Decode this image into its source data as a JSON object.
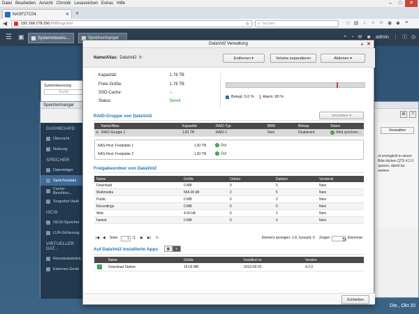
{
  "browser": {
    "menu": [
      "Datei",
      "Bearbeiten",
      "Ansicht",
      "Chronik",
      "Lesezeichen",
      "Extras",
      "Hilfe"
    ],
    "tab_title": "NASF27C04",
    "url_host": "192.168.178.150",
    "url_path": ":8080/cgi-bin/",
    "search_placeholder": "Suchen"
  },
  "qts": {
    "tabs": [
      "Systemsteueru...",
      "Speichermanger"
    ],
    "user": "admin",
    "taskbar_time": "Die., Okt 20"
  },
  "sysctl_popup": {
    "title": "Systemsteuerung",
    "search": "Suche"
  },
  "storage_manager": {
    "title": "Speichermanger",
    "sections": [
      {
        "title": "DASHBOARD",
        "items": [
          "Übersicht",
          "Nutzung"
        ]
      },
      {
        "title": "SPEICHER",
        "items": [
          "Datenträger",
          "Speicherplatz",
          "Cache-Beschleu...",
          "Snapshot Vault"
        ]
      },
      {
        "title": "iSCSI",
        "items": [
          "iSCSI-Speicher",
          "LUN-Sicherung"
        ]
      },
      {
        "title": "VIRTUELLER DAT...",
        "items": [
          "Remotedatenträ...",
          "Externes Gerät"
        ]
      }
    ],
    "active_item": "Speicherplatz",
    "right_button": "Verwalten",
    "right_note": "ot ermöglicht in einem Bitte klicken QTS 4.2.0 spasen, damit tur weitere"
  },
  "modal": {
    "title": "DataVol2 Verwaltung",
    "name_label": "Name/Alias:",
    "name_value": "DataVol2",
    "buttons": {
      "remove": "Entfernen",
      "expand": "Volume expandieren",
      "actions": "Aktionen"
    },
    "info": {
      "capacity_label": "Kapazität:",
      "capacity": "1.76 TB",
      "free_label": "Freie Größe:",
      "free": "1.76 TB",
      "ssd_label": "SSD-Cache:",
      "ssd": "--",
      "status_label": "Status:",
      "status": "Bereit"
    },
    "usage": {
      "used_label": "Belegt: 0.0 %",
      "alarm_label": "Alarm: 80 %",
      "used_pct": 0.0,
      "alarm_pct": 80
    },
    "raid": {
      "section_title": "RAID-Gruppe von DataVol2",
      "manage_button": "Verwalten",
      "headers": [
        "Name/Alias",
        "Kapazität",
        "RAID-Typ",
        "BBM",
        "Bitmap",
        "Status"
      ],
      "group": {
        "name": "RAID-Gruppe 1",
        "capacity": "1.81 TB",
        "type": "RAID 1",
        "bbm": "Nein",
        "bitmap": "Deaktiviert",
        "status": "Wird synchron..."
      },
      "disks": [
        {
          "name": "NAS-Host: Festplatte 1",
          "size": "1.82 TB",
          "status": "Gut"
        },
        {
          "name": "NAS-Host: Festplatte 2",
          "size": "1.82 TB",
          "status": "Gut"
        }
      ]
    },
    "shares": {
      "section_title": "Freigabeordner von DataVol2",
      "headers": [
        "Name",
        "Größe",
        "Ordner",
        "Dateien",
        "Versteckt"
      ],
      "rows": [
        [
          "Download",
          "0 MB",
          "0",
          "0",
          "Nein"
        ],
        [
          "Multimedia",
          "564.00 kB",
          "2",
          "5",
          "Nein"
        ],
        [
          "Public",
          "0 MB",
          "0",
          "0",
          "Nein"
        ],
        [
          "Recordings",
          "0 MB",
          "0",
          "0",
          "Nein"
        ],
        [
          "Web",
          "4.00 kB",
          "0",
          "1",
          "Nein"
        ],
        [
          "hwtest",
          "0 MB",
          "0",
          "0",
          "Nein"
        ]
      ],
      "pager": {
        "page_label": "Seite",
        "page": "1",
        "of": "/1",
        "info": "Element anzeigen: 1-6, Gesamt: 6",
        "show_label": "Zeigen",
        "show_value": "10",
        "items_label": "Elemente"
      }
    },
    "apps": {
      "section_title": "Auf DataVol2 installierte Apps",
      "headers": [
        "Name",
        "Größe",
        "Installed on",
        "Version"
      ],
      "rows": [
        [
          "Download Station",
          "14.02 MB",
          "2015-09-25",
          "4.2.0"
        ]
      ]
    },
    "close_button": "Schließen"
  }
}
